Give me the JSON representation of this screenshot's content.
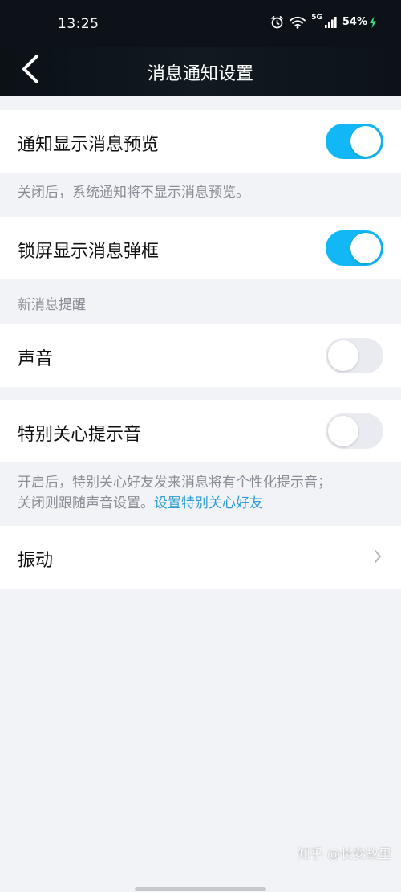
{
  "status_bar": {
    "time": "13:25",
    "network": "5G",
    "battery": "54%"
  },
  "nav": {
    "title": "消息通知设置",
    "back_icon": "chevron-left-icon"
  },
  "settings": {
    "preview": {
      "label": "通知显示消息预览",
      "enabled": true,
      "description": "关闭后，系统通知将不显示消息预览。"
    },
    "lock_screen": {
      "label": "锁屏显示消息弹框",
      "enabled": true
    },
    "section_header": "新消息提醒",
    "sound": {
      "label": "声音",
      "enabled": false
    },
    "special_care": {
      "label": "特别关心提示音",
      "enabled": false,
      "description_line1": "开启后，特别关心好友发来消息将有个性化提示音；",
      "description_line2_prefix": "关闭则跟随声音设置。",
      "description_link": "设置特别关心好友"
    },
    "vibration": {
      "label": "振动"
    }
  },
  "watermark": "知乎 @长安故里",
  "colors": {
    "toggle_on": "#12b7f5",
    "toggle_off": "#e9ebf0",
    "link": "#2d9ed3",
    "nav_background": "#0c1218",
    "page_background": "#f2f3f7"
  }
}
